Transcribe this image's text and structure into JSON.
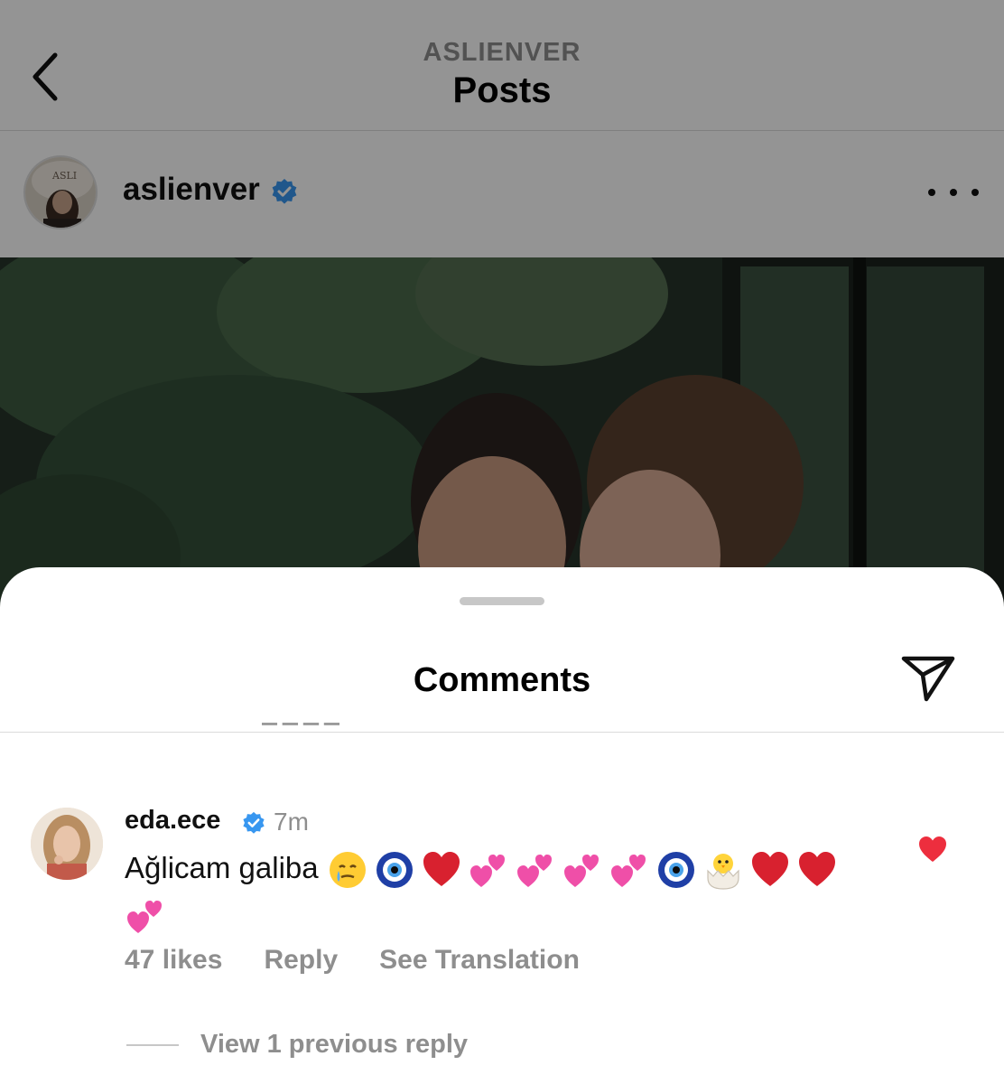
{
  "nav": {
    "account": "ASLIENVER",
    "title": "Posts"
  },
  "post": {
    "username": "aslienver",
    "verified": true,
    "avatar_text": "ASLI"
  },
  "comments_sheet": {
    "title": "Comments",
    "comment": {
      "username": "eda.ece",
      "verified": true,
      "time": "7m",
      "text": "Ağlicam galiba",
      "emojis": [
        "crying-smile",
        "nazar",
        "red-heart",
        "two-hearts",
        "two-hearts",
        "two-hearts",
        "two-hearts",
        "nazar",
        "hatching-chick",
        "red-heart",
        "red-heart",
        "two-hearts"
      ],
      "likes": "47 likes",
      "reply_label": "Reply",
      "translate_label": "See Translation",
      "view_replies": "View 1 previous reply",
      "liked": true
    }
  },
  "colors": {
    "verified_blue": "#3897f0",
    "like_red": "#ed2e3e",
    "secondary_text": "#8e8e8e"
  }
}
